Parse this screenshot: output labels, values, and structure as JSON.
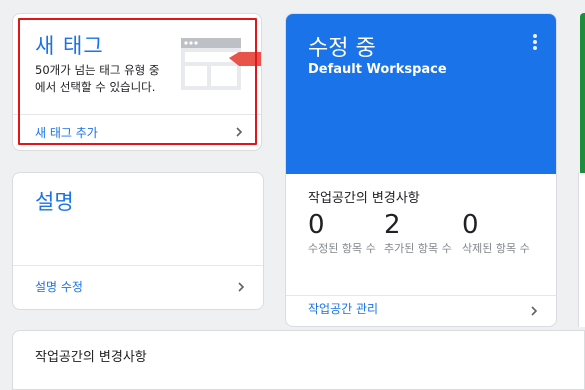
{
  "new_tag": {
    "title": "새 태그",
    "description": "50개가 넘는 태그 유형 중에서 선택할 수 있습니다.",
    "link": "새 태그 추가"
  },
  "description_card": {
    "title": "설명",
    "link": "설명 수정"
  },
  "workspace": {
    "title": "수정 중",
    "name": "Default Workspace",
    "changes_title": "작업공간의 변경사항",
    "stats": [
      {
        "value": "0",
        "label": "수정된 항목 수"
      },
      {
        "value": "2",
        "label": "추가된 항목 수"
      },
      {
        "value": "0",
        "label": "삭제된 항목 수"
      }
    ],
    "link": "작업공간 관리"
  },
  "bottom_card": {
    "title": "작업공간의 변경사항"
  },
  "colors": {
    "accent": "#1a73e8",
    "highlight_border": "#e0161b",
    "green": "#1e8e3e"
  }
}
